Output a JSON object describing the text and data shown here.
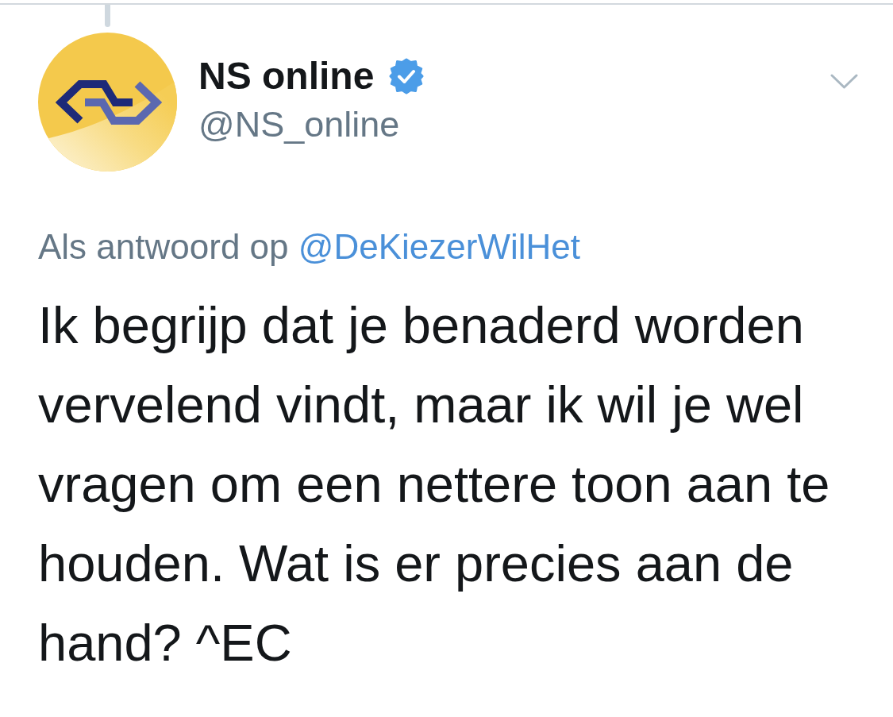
{
  "tweet": {
    "author": {
      "name": "NS online",
      "verified": true,
      "handle": "@NS_online"
    },
    "reply_to": {
      "prefix": "Als antwoord op",
      "handle": "@DeKiezerWilHet"
    },
    "text": "Ik begrijp dat je benaderd worden vervelend vindt, maar ik wil je wel vragen om een nettere toon aan te houden. Wat is er precies aan de hand? ^EC"
  }
}
